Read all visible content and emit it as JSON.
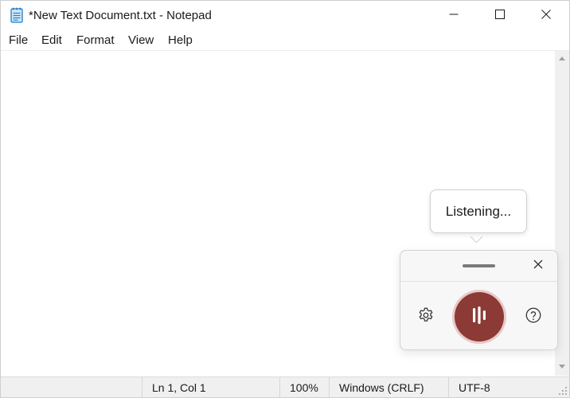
{
  "window": {
    "title": "*New Text Document.txt - Notepad"
  },
  "icons": {
    "app": "notepad-icon",
    "minimize": "minimize-icon",
    "maximize": "maximize-icon",
    "close": "close-icon",
    "settings": "gear-icon",
    "mic": "audio-bars-icon",
    "help": "question-circle-icon",
    "panel_close": "close-icon",
    "grip": "resize-grip-icon"
  },
  "menu": {
    "items": [
      "File",
      "Edit",
      "Format",
      "View",
      "Help"
    ]
  },
  "editor": {
    "content": ""
  },
  "status": {
    "position": "Ln 1, Col 1",
    "zoom": "100%",
    "line_ending": "Windows (CRLF)",
    "encoding": "UTF-8"
  },
  "voice": {
    "tooltip": "Listening..."
  },
  "colors": {
    "mic_button": "#8b3a36",
    "mic_ring": "#e8c9c7",
    "notepad_icon": "#1f7ec9"
  }
}
